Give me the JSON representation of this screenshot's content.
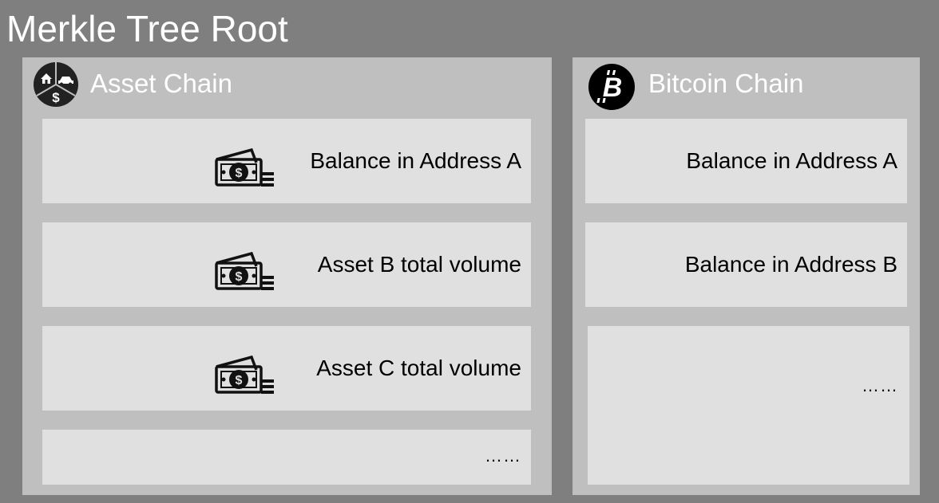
{
  "title": "Merkle Tree Root",
  "asset_chain": {
    "title": "Asset Chain",
    "icon": "asset-pie-icon",
    "items": [
      {
        "label": "Balance in Address A",
        "icon": "money-stack-icon"
      },
      {
        "label": "Asset B total volume",
        "icon": "money-stack-icon"
      },
      {
        "label": "Asset C total volume",
        "icon": "money-stack-icon"
      },
      {
        "label": "……"
      }
    ]
  },
  "bitcoin_chain": {
    "title": "Bitcoin Chain",
    "icon": "bitcoin-icon",
    "items": [
      {
        "label": "Balance in Address A"
      },
      {
        "label": "Balance in Address B"
      },
      {
        "label": "……"
      }
    ]
  },
  "colors": {
    "background": "#7f7f7f",
    "panel": "#bfbfbf",
    "item": "#e0e0e0",
    "title_text": "#ffffff"
  }
}
